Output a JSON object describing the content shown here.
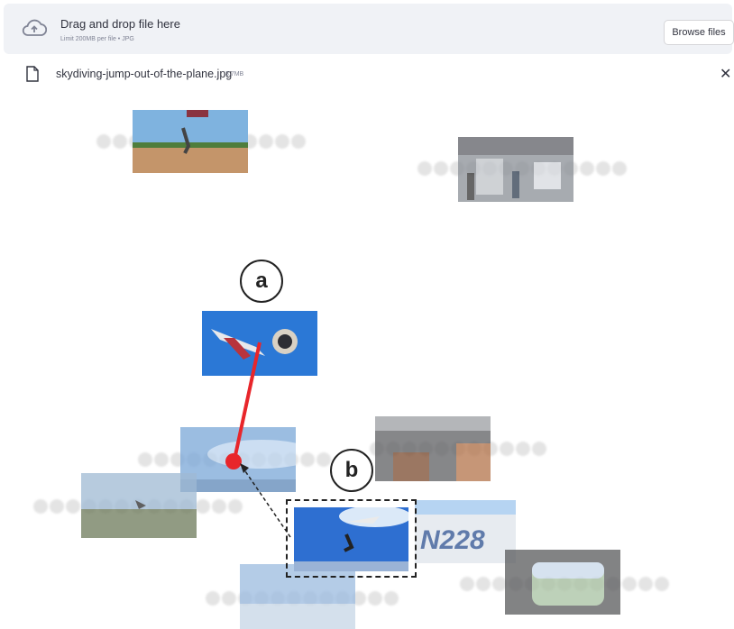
{
  "uploader": {
    "title": "Drag and drop file here",
    "limit": "Limit 200MB per file • JPG",
    "browse_label": "Browse files"
  },
  "file": {
    "name": "skydiving-jump-out-of-the-plane.jpg",
    "size": "3.7MB"
  },
  "labels": {
    "a": "a",
    "b": "b"
  },
  "colors": {
    "accent": "#e8262b",
    "panel": "#f0f2f6"
  }
}
